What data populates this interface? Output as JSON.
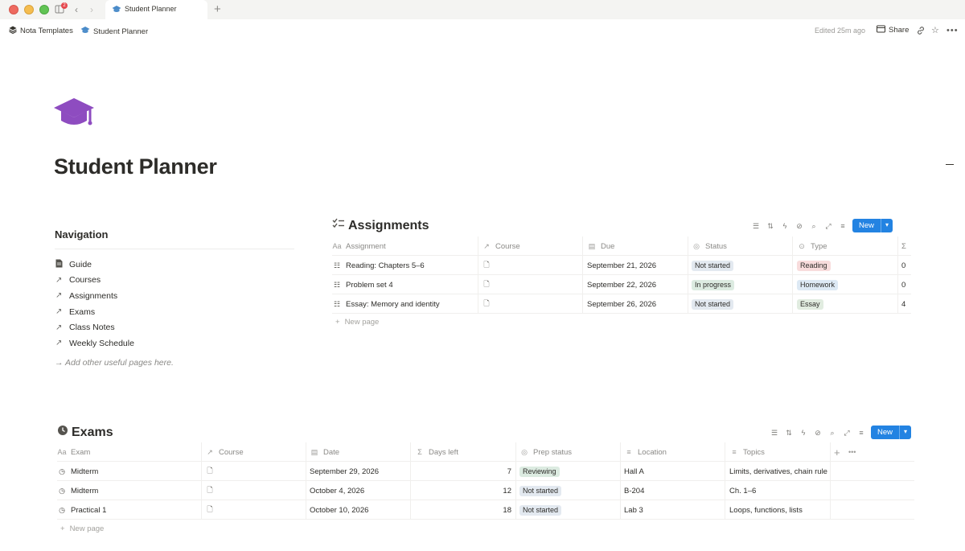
{
  "window": {
    "tab_title": "Student Planner",
    "tab_badge": "2",
    "tab_icon": "graduation-cap-icon"
  },
  "topbar": {
    "breadcrumbs": [
      {
        "label": "Nota Templates",
        "icon": "stack-icon"
      },
      {
        "label": "Student Planner",
        "icon": "graduation-cap-icon"
      }
    ],
    "edited": "Edited 25m ago",
    "share_label": "Share"
  },
  "page": {
    "title": "Student Planner",
    "icon": "graduation-cap-icon",
    "icon_color": "#8e4cc0"
  },
  "navigation": {
    "heading": "Navigation",
    "items": [
      {
        "label": "Guide",
        "icon": "page-icon"
      },
      {
        "label": "Courses",
        "icon": "link-arrow-icon"
      },
      {
        "label": "Assignments",
        "icon": "link-arrow-icon"
      },
      {
        "label": "Exams",
        "icon": "link-arrow-icon"
      },
      {
        "label": "Class Notes",
        "icon": "link-arrow-icon"
      },
      {
        "label": "Weekly Schedule",
        "icon": "link-arrow-icon"
      }
    ],
    "hint": "→ Add other useful pages here."
  },
  "assignments": {
    "title": "Assignments",
    "new_label": "New",
    "new_page_label": "New page",
    "columns": [
      "Assignment",
      "Course",
      "Due",
      "Status",
      "Type",
      "Σ"
    ],
    "rows": [
      {
        "name": "Reading: Chapters 5–6",
        "due": "September 21, 2026",
        "status": "Not started",
        "type": "Reading",
        "count": "0"
      },
      {
        "name": "Problem set 4",
        "due": "September 22, 2026",
        "status": "In progress",
        "type": "Homework",
        "count": "0"
      },
      {
        "name": "Essay: Memory and identity",
        "due": "September 26, 2026",
        "status": "Not started",
        "type": "Essay",
        "count": "4"
      }
    ]
  },
  "exams": {
    "title": "Exams",
    "new_label": "New",
    "new_page_label": "New page",
    "columns": [
      "Exam",
      "Course",
      "Date",
      "Days left",
      "Prep status",
      "Location",
      "Topics"
    ],
    "rows": [
      {
        "name": "Midterm",
        "date": "September 29, 2026",
        "days": "7",
        "prep": "Reviewing",
        "location": "Hall A",
        "topics": "Limits, derivatives, chain rule"
      },
      {
        "name": "Midterm",
        "date": "October 4, 2026",
        "days": "12",
        "prep": "Not started",
        "location": "B-204",
        "topics": "Ch. 1–6"
      },
      {
        "name": "Practical 1",
        "date": "October 10, 2026",
        "days": "18",
        "prep": "Not started",
        "location": "Lab 3",
        "topics": "Loops, functions, lists"
      }
    ]
  },
  "colors": {
    "accent": "#2383e2",
    "status_not_started_bg": "#e3e9f0",
    "status_in_progress_bg": "#dcebe1",
    "status_reviewing_bg": "#dcebe1",
    "type_reading_bg": "#f8dcdc",
    "type_homework_bg": "#dde9f4",
    "type_essay_bg": "#e1ece0"
  }
}
